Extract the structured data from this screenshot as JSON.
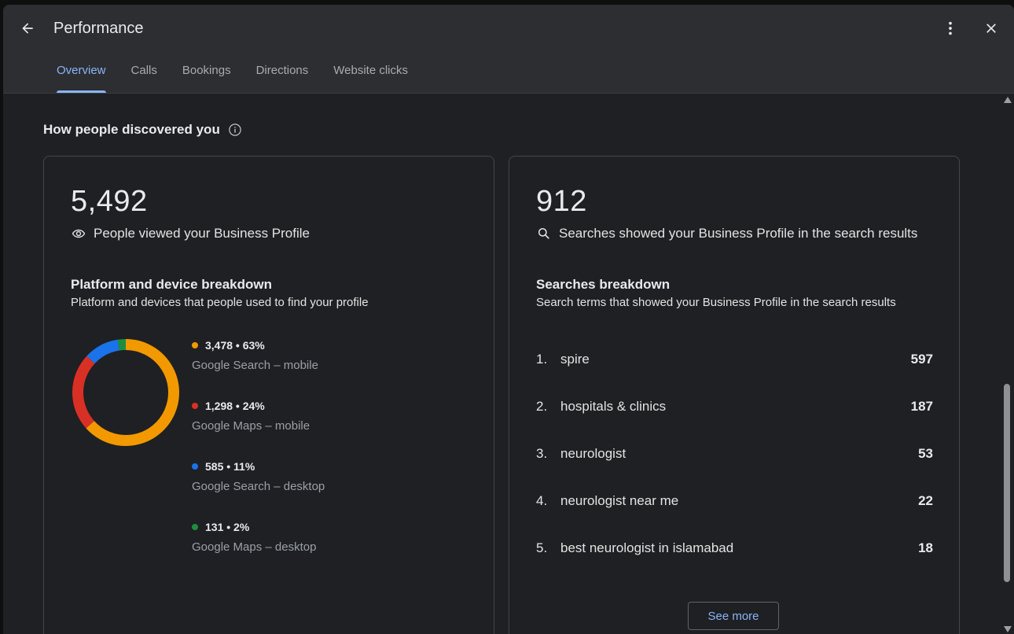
{
  "header": {
    "title": "Performance",
    "tabs": [
      {
        "label": "Overview",
        "active": true
      },
      {
        "label": "Calls",
        "active": false
      },
      {
        "label": "Bookings",
        "active": false
      },
      {
        "label": "Directions",
        "active": false
      },
      {
        "label": "Website clicks",
        "active": false
      }
    ]
  },
  "section": {
    "title": "How people discovered you",
    "info_icon": "info-icon"
  },
  "views_card": {
    "total": "5,492",
    "label": "People viewed your Business Profile",
    "label_icon": "eye-icon",
    "breakdown_title": "Platform and device breakdown",
    "breakdown_desc": "Platform and devices that people used to find your profile",
    "items": [
      {
        "value": "3,478 • 63%",
        "label": "Google Search – mobile",
        "color": "#f29900",
        "count": 3478
      },
      {
        "value": "1,298 • 24%",
        "label": "Google Maps – mobile",
        "color": "#d93025",
        "count": 1298
      },
      {
        "value": "585 • 11%",
        "label": "Google Search – desktop",
        "color": "#1a73e8",
        "count": 585
      },
      {
        "value": "131 • 2%",
        "label": "Google Maps – desktop",
        "color": "#1e8e3e",
        "count": 131
      }
    ]
  },
  "searches_card": {
    "total": "912",
    "label": "Searches showed your Business Profile in the search results",
    "label_icon": "search-icon",
    "breakdown_title": "Searches breakdown",
    "breakdown_desc": "Search terms that showed your Business Profile in the search results",
    "items": [
      {
        "rank": "1.",
        "term": "spire",
        "count": "597"
      },
      {
        "rank": "2.",
        "term": "hospitals & clinics",
        "count": "187"
      },
      {
        "rank": "3.",
        "term": "neurologist",
        "count": "53"
      },
      {
        "rank": "4.",
        "term": "neurologist near me",
        "count": "22"
      },
      {
        "rank": "5.",
        "term": "best neurologist in islamabad",
        "count": "18"
      }
    ],
    "see_more_label": "See more"
  }
}
